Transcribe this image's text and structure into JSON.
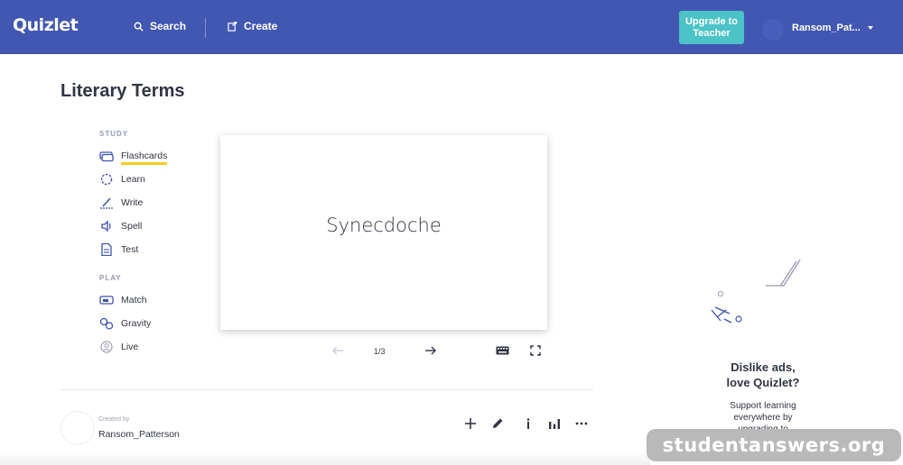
{
  "app": {
    "logo": "Quizlet",
    "nav": {
      "search_label": "Search",
      "create_label": "Create"
    },
    "upgrade_label": "Upgrade to\nTeacher",
    "username": "Ransom_Pat...",
    "brand_color": "#4257b2",
    "accent_color": "#4bc3c7"
  },
  "page": {
    "title": "Literary Terms"
  },
  "sidebar": {
    "study_label": "STUDY",
    "study_items": [
      {
        "label": "Flashcards",
        "icon": "flashcards-icon"
      },
      {
        "label": "Learn",
        "icon": "learn-icon"
      },
      {
        "label": "Write",
        "icon": "write-icon"
      },
      {
        "label": "Spell",
        "icon": "spell-icon"
      },
      {
        "label": "Test",
        "icon": "test-icon"
      }
    ],
    "play_label": "PLAY",
    "play_items": [
      {
        "label": "Match",
        "icon": "match-icon"
      },
      {
        "label": "Gravity",
        "icon": "gravity-icon"
      },
      {
        "label": "Live",
        "icon": "live-icon"
      }
    ],
    "active_item": "Flashcards",
    "active_underline_color": "#ffcd1f"
  },
  "card": {
    "term": "Synecdoche",
    "counter": "1/3"
  },
  "creator": {
    "created_by_label": "Created by",
    "name": "Ransom_Patterson"
  },
  "ad": {
    "title": "Dislike ads,\nlove Quizlet?",
    "text": "Support learning\neverywhere by\nupgrading to"
  },
  "watermark": "studentanswers.org"
}
